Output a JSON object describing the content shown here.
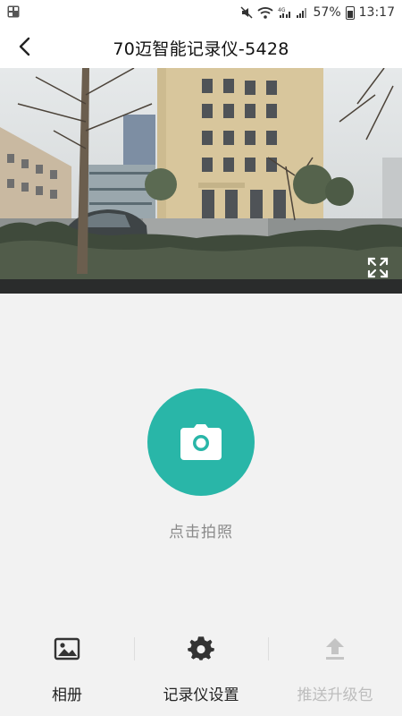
{
  "status_bar": {
    "battery_percent": "57%",
    "time": "13:17",
    "left_icon": "gallery-notification-icon",
    "icons": [
      "mute-icon",
      "wifi-icon",
      "signal-4g-icon",
      "signal-icon",
      "battery-icon"
    ]
  },
  "header": {
    "title": "70迈智能记录仪-5428",
    "back_icon": "back-arrow-icon"
  },
  "video": {
    "fullscreen_icon": "expand-icon"
  },
  "capture": {
    "icon": "camera-icon",
    "label": "点击拍照",
    "color": "#29b6a8"
  },
  "bottom_tabs": [
    {
      "label": "相册",
      "icon": "image-icon",
      "enabled": true
    },
    {
      "label": "记录仪设置",
      "icon": "gear-icon",
      "enabled": true
    },
    {
      "label": "推送升级包",
      "icon": "upload-icon",
      "enabled": false
    }
  ]
}
